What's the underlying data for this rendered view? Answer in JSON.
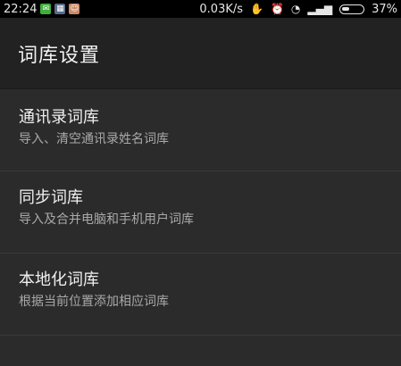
{
  "status_bar": {
    "time": "22:24",
    "network_speed": "0.03K/s",
    "battery": "37%",
    "battery_level": 0.37,
    "icons": [
      "wechat-icon",
      "gallery-icon",
      "avatar-notification-icon",
      "vibrate-icon",
      "alarm-icon",
      "wifi-icon",
      "signal-icon",
      "battery-icon"
    ]
  },
  "header": {
    "title": "词库设置"
  },
  "items": [
    {
      "title": "通讯录词库",
      "subtitle": "导入、清空通讯录姓名词库"
    },
    {
      "title": "同步词库",
      "subtitle": "导入及合并电脑和手机用户词库"
    },
    {
      "title": "本地化词库",
      "subtitle": "根据当前位置添加相应词库"
    }
  ],
  "colors": {
    "background": "#2b2b2b",
    "app_bar": "#222222",
    "status_bar": "#000000",
    "divider": "#3a3a3a"
  }
}
